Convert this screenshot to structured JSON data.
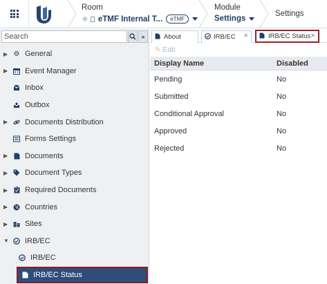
{
  "header": {
    "room_label": "Room",
    "room_value": "eTMF Internal T...",
    "room_badge": "eTMF",
    "module_label": "Module",
    "module_value": "Settings",
    "page_crumb": "Settings"
  },
  "sidebar": {
    "search_placeholder": "Search",
    "items": [
      {
        "label": "General",
        "icon": "gears-icon"
      },
      {
        "label": "Event Manager",
        "icon": "calendar-icon"
      },
      {
        "label": "Inbox",
        "icon": "inbox-icon"
      },
      {
        "label": "Outbox",
        "icon": "outbox-icon"
      },
      {
        "label": "Documents Distribution",
        "icon": "link-icon"
      },
      {
        "label": "Forms Settings",
        "icon": "form-icon"
      },
      {
        "label": "Documents",
        "icon": "document-icon"
      },
      {
        "label": "Document Types",
        "icon": "tag-icon"
      },
      {
        "label": "Required Documents",
        "icon": "clipboard-icon"
      },
      {
        "label": "Countries",
        "icon": "globe-icon"
      },
      {
        "label": "Sites",
        "icon": "buildings-icon"
      },
      {
        "label": "IRB/EC",
        "icon": "circle-check-icon"
      },
      {
        "label": "IRB/EC",
        "icon": "circle-check-icon"
      },
      {
        "label": "IRB/EC Status",
        "icon": "document-icon"
      }
    ]
  },
  "tabs": [
    {
      "label": "About"
    },
    {
      "label": "IRB/EC"
    },
    {
      "label": "IRB/EC Status"
    }
  ],
  "toolbar": {
    "edit_label": "Edit"
  },
  "grid": {
    "columns": [
      "Display Name",
      "Disabled"
    ],
    "rows": [
      [
        "Pending",
        "No"
      ],
      [
        "Submitted",
        "No"
      ],
      [
        "Conditional Approval",
        "No"
      ],
      [
        "Approved",
        "No"
      ],
      [
        "Rejected",
        "No"
      ]
    ]
  },
  "colors": {
    "accent": "#1f3f66",
    "selected_bg": "#2f4d7a",
    "highlight_border": "#a01e2a"
  }
}
